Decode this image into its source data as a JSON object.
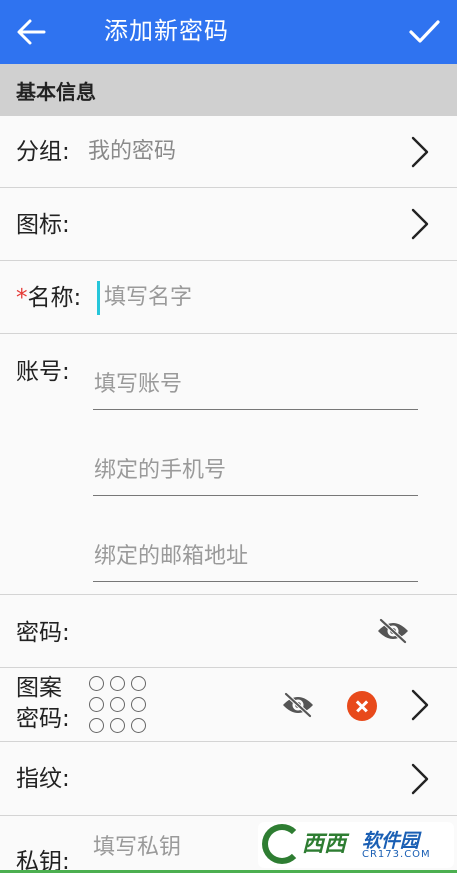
{
  "appbar": {
    "title": "添加新密码",
    "back_icon": "arrow-left-icon",
    "confirm_icon": "check-icon",
    "bg_color": "#2f73f0"
  },
  "section": {
    "title": "基本信息"
  },
  "group": {
    "label": "分组:",
    "value": "我的密码"
  },
  "icon_row": {
    "label": "图标:"
  },
  "name": {
    "required_mark": "*",
    "label": "名称:",
    "placeholder": "填写名字"
  },
  "account": {
    "label": "账号:",
    "fields": [
      {
        "placeholder": "填写账号"
      },
      {
        "placeholder": "绑定的手机号"
      },
      {
        "placeholder": "绑定的邮箱地址"
      }
    ]
  },
  "password": {
    "label": "密码:"
  },
  "pattern": {
    "label_line1": "图案",
    "label_line2": "密码:"
  },
  "fingerprint": {
    "label": "指纹:"
  },
  "private_key": {
    "label": "私钥:",
    "placeholder": "填写私钥"
  },
  "watermark": {
    "brand_main": "西西",
    "brand_sub": "软件园",
    "url": "CR173.COM"
  }
}
